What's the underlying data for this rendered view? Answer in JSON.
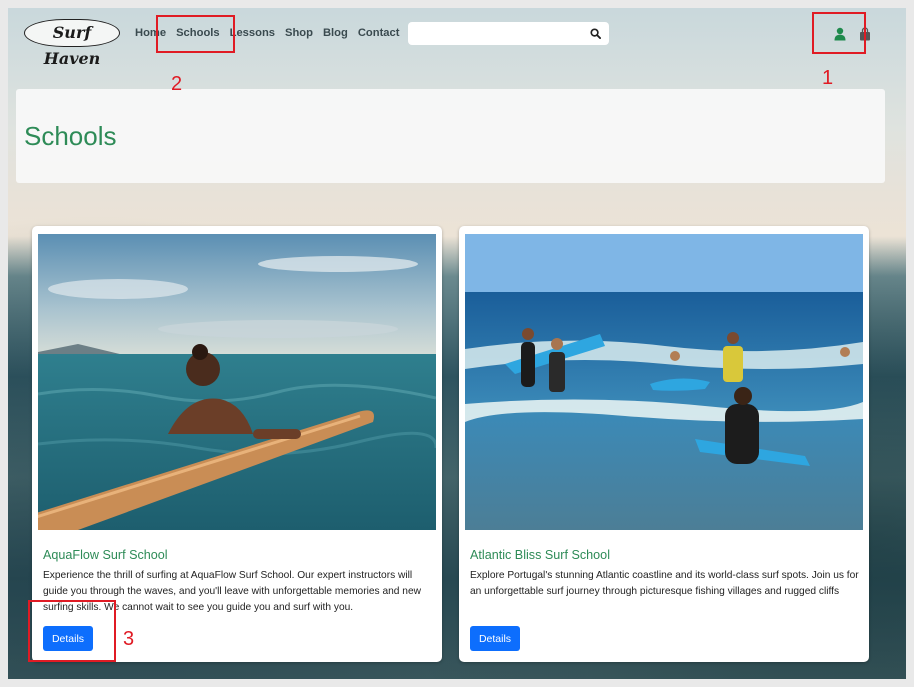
{
  "navbar": {
    "logo_text": "Surf Haven",
    "links": [
      "Home",
      "Schools",
      "Lessons",
      "Shop",
      "Blog",
      "Contact"
    ],
    "search_placeholder": "",
    "search_icon": "search-icon",
    "user_icon": "user-icon",
    "cart_icon": "cart-icon"
  },
  "page": {
    "title": "Schools"
  },
  "cards": [
    {
      "title": "AquaFlow Surf School",
      "text": "Experience the thrill of surfing at AquaFlow Surf School. Our expert instructors will guide you through the waves, and you'll leave with unforgettable memories and new surfing skills. We cannot wait to see you guide you and surf with you.",
      "button": "Details"
    },
    {
      "title": "Atlantic Bliss Surf School",
      "text": "Explore Portugal's stunning Atlantic coastline and its world-class surf spots. Join us for an unforgettable surf journey through picturesque fishing villages and rugged cliffs",
      "button": "Details"
    }
  ],
  "annotations": [
    "1",
    "2",
    "3"
  ],
  "colors": {
    "accent_green": "#2e8b57",
    "primary_blue": "#0d6efd",
    "annotation_red": "#e01b24"
  }
}
